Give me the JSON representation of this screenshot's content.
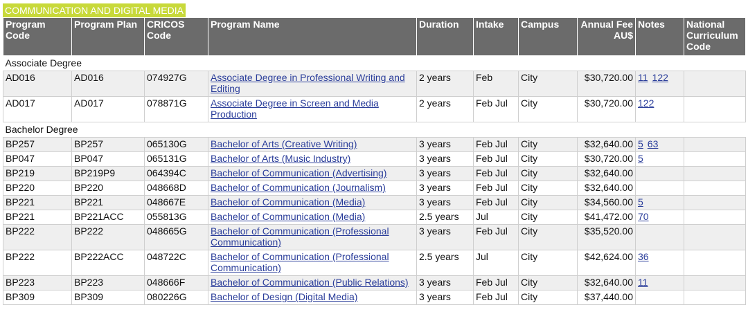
{
  "section_title": "COMMUNICATION AND DIGITAL MEDIA",
  "headers": {
    "program_code": "Program Code",
    "program_plan": "Program Plan",
    "cricos_code": "CRICOS Code",
    "program_name": "Program Name",
    "duration": "Duration",
    "intake": "Intake",
    "campus": "Campus",
    "annual_fee": "Annual Fee AU$",
    "notes": "Notes",
    "national_code": "National Curriculum Code"
  },
  "groups": [
    {
      "label": "Associate Degree",
      "rows": [
        {
          "code": "AD016",
          "plan": "AD016",
          "cricos": "074927G",
          "name": "Associate Degree in Professional Writing and Editing",
          "duration": "2 years",
          "intake": "Feb",
          "campus": "City",
          "fee": "$30,720.00",
          "notes": [
            "11",
            "122"
          ],
          "national": ""
        },
        {
          "code": "AD017",
          "plan": "AD017",
          "cricos": "078871G",
          "name": "Associate Degree in Screen and Media Production",
          "duration": "2 years",
          "intake": "Feb Jul",
          "campus": "City",
          "fee": "$30,720.00",
          "notes": [
            "122"
          ],
          "national": ""
        }
      ]
    },
    {
      "label": "Bachelor Degree",
      "rows": [
        {
          "code": "BP257",
          "plan": "BP257",
          "cricos": "065130G",
          "name": "Bachelor of Arts (Creative Writing)",
          "duration": "3 years",
          "intake": "Feb Jul",
          "campus": "City",
          "fee": "$32,640.00",
          "notes": [
            "5",
            "63"
          ],
          "national": ""
        },
        {
          "code": "BP047",
          "plan": "BP047",
          "cricos": "065131G",
          "name": "Bachelor of Arts (Music Industry)",
          "duration": "3 years",
          "intake": "Feb Jul",
          "campus": "City",
          "fee": "$30,720.00",
          "notes": [
            "5"
          ],
          "national": ""
        },
        {
          "code": "BP219",
          "plan": "BP219P9",
          "cricos": "064394C",
          "name": "Bachelor of Communication (Advertising)",
          "duration": "3 years",
          "intake": "Feb Jul",
          "campus": "City",
          "fee": "$32,640.00",
          "notes": [],
          "national": ""
        },
        {
          "code": "BP220",
          "plan": "BP220",
          "cricos": "048668D",
          "name": "Bachelor of Communication (Journalism)",
          "duration": "3 years",
          "intake": "Feb Jul",
          "campus": "City",
          "fee": "$32,640.00",
          "notes": [],
          "national": ""
        },
        {
          "code": "BP221",
          "plan": "BP221",
          "cricos": "048667E",
          "name": "Bachelor of Communication (Media)",
          "duration": "3 years",
          "intake": "Feb Jul",
          "campus": "City",
          "fee": "$34,560.00",
          "notes": [
            "5"
          ],
          "national": ""
        },
        {
          "code": "BP221",
          "plan": "BP221ACC",
          "cricos": "055813G",
          "name": "Bachelor of Communication (Media)",
          "duration": "2.5 years",
          "intake": "Jul",
          "campus": "City",
          "fee": "$41,472.00",
          "notes": [
            "70"
          ],
          "national": ""
        },
        {
          "code": "BP222",
          "plan": "BP222",
          "cricos": "048665G",
          "name": "Bachelor of Communication (Professional Communication)",
          "duration": "3 years",
          "intake": "Feb Jul",
          "campus": "City",
          "fee": "$35,520.00",
          "notes": [],
          "national": ""
        },
        {
          "code": "BP222",
          "plan": "BP222ACC",
          "cricos": "048722C",
          "name": "Bachelor of Communication (Professional Communication)",
          "duration": "2.5 years",
          "intake": "Jul",
          "campus": "City",
          "fee": "$42,624.00",
          "notes": [
            "36"
          ],
          "national": ""
        },
        {
          "code": "BP223",
          "plan": "BP223",
          "cricos": "048666F",
          "name": "Bachelor of Communication (Public Relations)",
          "duration": "3 years",
          "intake": "Feb Jul",
          "campus": "City",
          "fee": "$32,640.00",
          "notes": [
            "11"
          ],
          "national": ""
        },
        {
          "code": "BP309",
          "plan": "BP309",
          "cricos": "080226G",
          "name": "Bachelor of Design (Digital Media)",
          "duration": "3 years",
          "intake": "Feb Jul",
          "campus": "City",
          "fee": "$37,440.00",
          "notes": [],
          "national": ""
        }
      ]
    }
  ]
}
